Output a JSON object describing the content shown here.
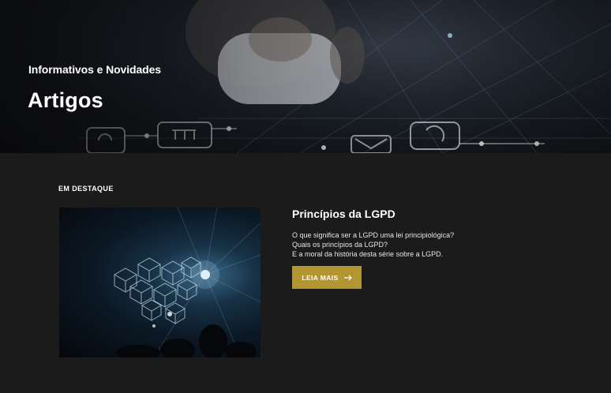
{
  "hero": {
    "subtitle": "Informativos e Novidades",
    "title": "Artigos"
  },
  "featured": {
    "section_label": "EM DESTAQUE",
    "title": "Princípios da LGPD",
    "excerpt": [
      "O que significa ser a LGPD uma lei principiológica?",
      "Quais os princípios da LGPD?",
      "E a moral da história desta série sobre a LGPD."
    ],
    "button_label": "LEIA MAIS",
    "button_icon": "arrow-right-icon"
  },
  "colors": {
    "background": "#1b1b1b",
    "accent": "#b39531",
    "text": "#ffffff"
  }
}
